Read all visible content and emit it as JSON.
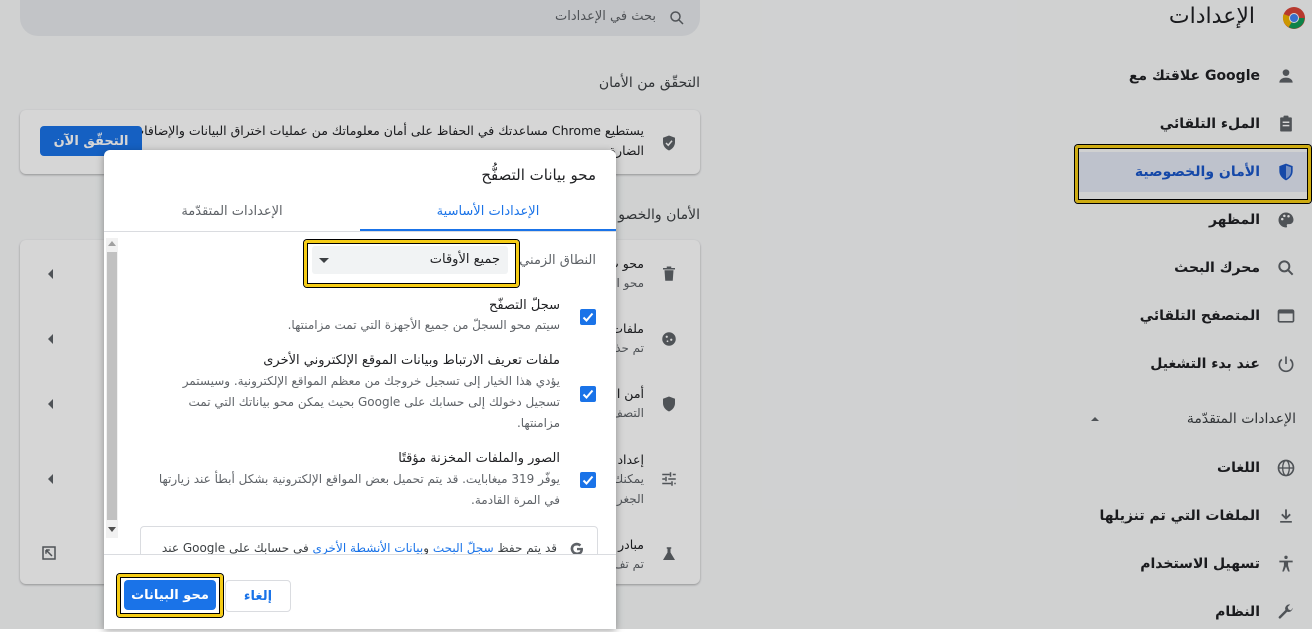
{
  "app": {
    "title": "الإعدادات"
  },
  "search": {
    "placeholder": "بحث في الإعدادات"
  },
  "sidebar": {
    "items": [
      {
        "label": "علاقتك مع Google",
        "icon": "person-icon"
      },
      {
        "label": "الملء التلقائي",
        "icon": "clipboard-icon"
      },
      {
        "label": "الأمان والخصوصية",
        "icon": "shield-icon"
      },
      {
        "label": "المظهر",
        "icon": "palette-icon"
      },
      {
        "label": "محرك البحث",
        "icon": "search-icon"
      },
      {
        "label": "المتصفح التلقائي",
        "icon": "browser-icon"
      },
      {
        "label": "عند بدء التشغيل",
        "icon": "power-icon"
      }
    ],
    "advanced_label": "الإعدادات المتقدّمة",
    "advanced_items": [
      {
        "label": "اللغات",
        "icon": "globe-icon"
      },
      {
        "label": "الملفات التي تم تنزيلها",
        "icon": "download-icon"
      },
      {
        "label": "تسهيل الاستخدام",
        "icon": "accessibility-icon"
      },
      {
        "label": "النظام",
        "icon": "wrench-icon"
      }
    ]
  },
  "main": {
    "safety_title": "التحقّق من الأمان",
    "safety_text_1": "يستطيع Chrome مساعدتك في الحفاظ على أمان معلوماتك من عمليات اختراق البيانات والإضافات",
    "safety_text_2": "الضارة",
    "safety_button": "التحقّق الآن",
    "privacy_title": "الأمان والخصو",
    "rows": [
      {
        "title": "محو ب",
        "sub": "محو ا"
      },
      {
        "title": "ملفات",
        "sub": "تم حذ"
      },
      {
        "title": "أمن ا",
        "sub": "التصف"
      },
      {
        "title": "إعداد",
        "sub": "يمكنك",
        "sub2": "الجغر"
      },
      {
        "title": "مبادر",
        "sub": "تم تف"
      }
    ]
  },
  "dialog": {
    "title": "محو بيانات التصفُّح",
    "tab_basic": "الإعدادات الأساسية",
    "tab_advanced": "الإعدادات المتقدّمة",
    "time_range_label": "النطاق الزمني",
    "time_range_value": "جميع الأوقات",
    "options": [
      {
        "title": "سجلّ التصفّح",
        "desc": [
          "سيتم محو السجلّ من جميع الأجهزة التي تمت مزامنتها."
        ],
        "checked": true
      },
      {
        "title": "ملفات تعريف الارتباط وبيانات الموقع الإلكتروني الأخرى",
        "desc": [
          "يؤدي هذا الخيار إلى تسجيل خروجك من معظم المواقع الإلكترونية. وسيستمر",
          "تسجيل دخولك إلى حسابك على Google بحيث يمكن محو بياناتك التي تمت",
          "مزامنتها."
        ],
        "checked": true
      },
      {
        "title": "الصور والملفات المخزنة مؤقتًا",
        "desc": [
          "يوفّر 319 ميغابايت. قد يتم تحميل بعض المواقع الإلكترونية بشكل أبطأ عند زيارتها",
          "في المرة القادمة."
        ],
        "checked": true
      }
    ],
    "info_prefix": "قد يتم حفظ",
    "info_link1": "سجلّ البحث",
    "info_and": "و",
    "info_link2": "بيانات الأنشطة الأخرى",
    "info_suffix": "في حسابك على Google عند",
    "cancel_label": "إلغاء",
    "clear_label": "محو البيانات"
  },
  "colors": {
    "accent": "#1a73e8",
    "highlight": "#f5cc16"
  }
}
